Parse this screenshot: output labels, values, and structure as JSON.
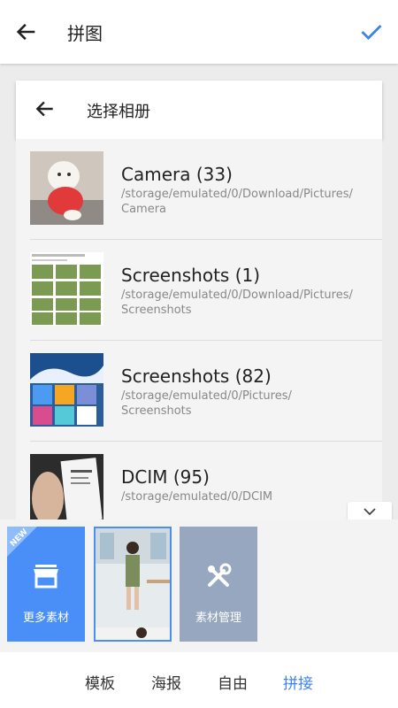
{
  "topbar": {
    "title": "拼图"
  },
  "panel": {
    "title": "选择相册"
  },
  "albums": [
    {
      "name": "Camera (33)",
      "path": "/storage/emulated/0/Download/Pictures/\nCamera"
    },
    {
      "name": "Screenshots (1)",
      "path": "/storage/emulated/0/Download/Pictures/\nScreenshots"
    },
    {
      "name": "Screenshots (82)",
      "path": "/storage/emulated/0/Pictures/\nScreenshots"
    },
    {
      "name": "DCIM (95)",
      "path": "/storage/emulated/0/DCIM"
    }
  ],
  "tray": {
    "more_label": "更多素材",
    "new_badge": "NEW",
    "manage_label": "素材管理"
  },
  "tabs": [
    {
      "label": "模板"
    },
    {
      "label": "海报"
    },
    {
      "label": "自由"
    },
    {
      "label": "拼接"
    }
  ],
  "colors": {
    "accent": "#3b82f6",
    "tile_blue": "#4a8ff7",
    "tile_gray": "#96a7bf"
  }
}
